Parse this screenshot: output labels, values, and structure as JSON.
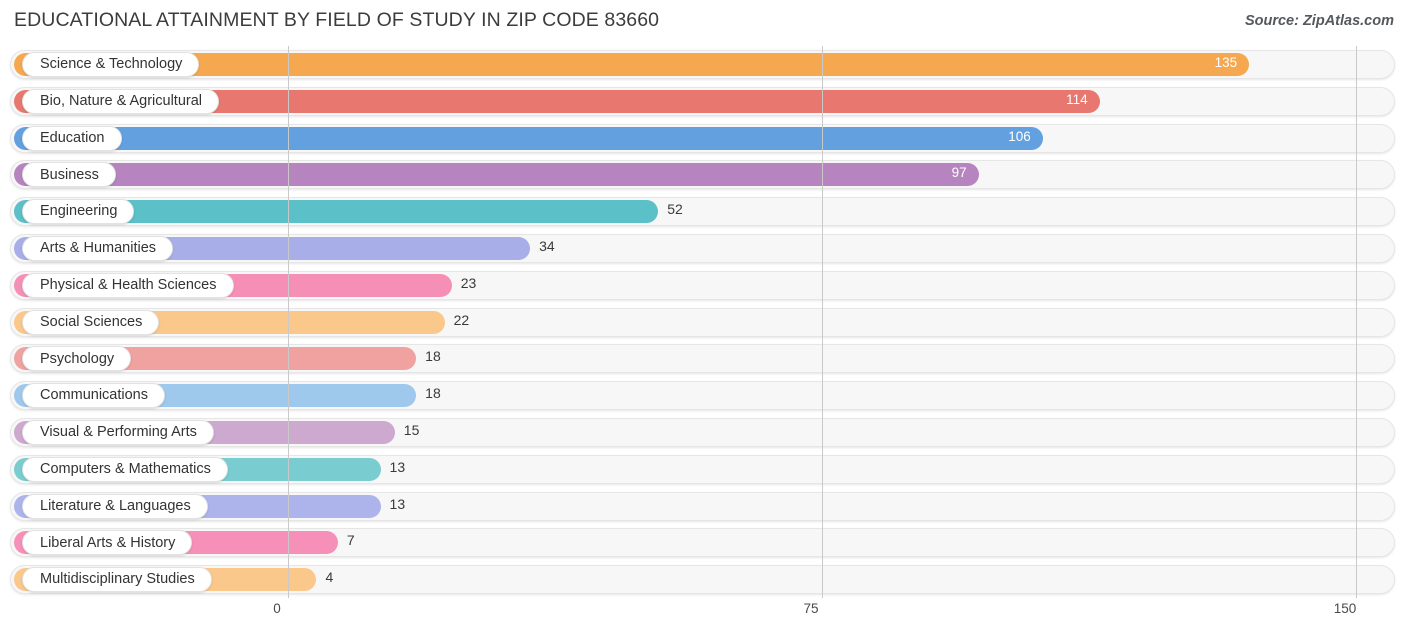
{
  "header": {
    "title": "EDUCATIONAL ATTAINMENT BY FIELD OF STUDY IN ZIP CODE 83660",
    "source": "Source: ZipAtlas.com"
  },
  "chart_data": {
    "type": "bar",
    "orientation": "horizontal",
    "title": "EDUCATIONAL ATTAINMENT BY FIELD OF STUDY IN ZIP CODE 83660",
    "subtitle": "",
    "xlabel": "",
    "ylabel": "",
    "xlim": [
      0,
      150
    ],
    "ticks": [
      "0",
      "75",
      "150"
    ],
    "tick_values": [
      0,
      75,
      150
    ],
    "grid": true,
    "legend": false,
    "categories": [
      "Science & Technology",
      "Bio, Nature & Agricultural",
      "Education",
      "Business",
      "Engineering",
      "Arts & Humanities",
      "Physical & Health Sciences",
      "Social Sciences",
      "Psychology",
      "Communications",
      "Visual & Performing Arts",
      "Computers & Mathematics",
      "Literature & Languages",
      "Liberal Arts & History",
      "Multidisciplinary Studies"
    ],
    "values": [
      135,
      114,
      106,
      97,
      52,
      34,
      23,
      22,
      18,
      18,
      15,
      13,
      13,
      7,
      4
    ],
    "value_labels": [
      "135",
      "114",
      "106",
      "97",
      "52",
      "34",
      "23",
      "22",
      "18",
      "18",
      "15",
      "13",
      "13",
      "7",
      "4"
    ],
    "colors": [
      "#f6a850",
      "#e8786f",
      "#63a0e0",
      "#b684be",
      "#5bc0c8",
      "#a8aee8",
      "#f68fb6",
      "#fbc88b",
      "#efa2a0",
      "#9ec8ec",
      "#cda8cf",
      "#79cdd0",
      "#adb4ec",
      "#f790b8",
      "#fbc88b"
    ],
    "label_inside": [
      true,
      true,
      true,
      true,
      false,
      false,
      false,
      false,
      false,
      false,
      false,
      false,
      false,
      false,
      false
    ]
  }
}
